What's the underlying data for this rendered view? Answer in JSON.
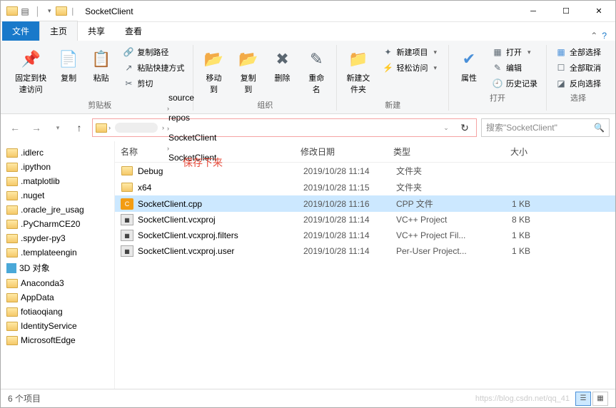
{
  "window": {
    "title": "SocketClient"
  },
  "ribbon_tabs": {
    "file": "文件",
    "home": "主页",
    "share": "共享",
    "view": "查看"
  },
  "ribbon": {
    "clipboard": {
      "label": "剪贴板",
      "pin": "固定到快速访问",
      "copy": "复制",
      "paste": "粘贴",
      "copy_path": "复制路径",
      "paste_shortcut": "粘贴快捷方式",
      "cut": "剪切"
    },
    "organize": {
      "label": "组织",
      "move_to": "移动到",
      "copy_to": "复制到",
      "delete": "删除",
      "rename": "重命名"
    },
    "new": {
      "label": "新建",
      "new_folder": "新建文件夹",
      "new_item": "新建项目",
      "easy_access": "轻松访问"
    },
    "open": {
      "label": "打开",
      "properties": "属性",
      "open": "打开",
      "edit": "编辑",
      "history": "历史记录"
    },
    "select": {
      "label": "选择",
      "select_all": "全部选择",
      "select_none": "全部取消",
      "invert": "反向选择"
    }
  },
  "breadcrumbs": [
    "source",
    "repos",
    "SocketClient",
    "SocketClient"
  ],
  "search": {
    "placeholder": "搜索\"SocketClient\""
  },
  "columns": {
    "name": "名称",
    "date": "修改日期",
    "type": "类型",
    "size": "大小"
  },
  "tree": [
    ".idlerc",
    ".ipython",
    ".matplotlib",
    ".nuget",
    ".oracle_jre_usag",
    ".PyCharmCE20",
    ".spyder-py3",
    ".templateengin",
    "3D 对象",
    "Anaconda3",
    "AppData",
    "fotiaoqiang",
    "IdentityService",
    "MicrosoftEdge"
  ],
  "annotation": "保存下来",
  "files": [
    {
      "name": "Debug",
      "icon": "folder",
      "date": "2019/10/28 11:14",
      "type": "文件夹",
      "size": ""
    },
    {
      "name": "x64",
      "icon": "folder",
      "date": "2019/10/28 11:15",
      "type": "文件夹",
      "size": ""
    },
    {
      "name": "SocketClient.cpp",
      "icon": "cpp",
      "date": "2019/10/28 11:16",
      "type": "CPP 文件",
      "size": "1 KB",
      "selected": true
    },
    {
      "name": "SocketClient.vcxproj",
      "icon": "vcx",
      "date": "2019/10/28 11:14",
      "type": "VC++ Project",
      "size": "8 KB"
    },
    {
      "name": "SocketClient.vcxproj.filters",
      "icon": "vcx",
      "date": "2019/10/28 11:14",
      "type": "VC++ Project Fil...",
      "size": "1 KB"
    },
    {
      "name": "SocketClient.vcxproj.user",
      "icon": "vcx",
      "date": "2019/10/28 11:14",
      "type": "Per-User Project...",
      "size": "1 KB"
    }
  ],
  "status": {
    "count": "6 个项目",
    "watermark": "https://blog.csdn.net/qq_41"
  }
}
